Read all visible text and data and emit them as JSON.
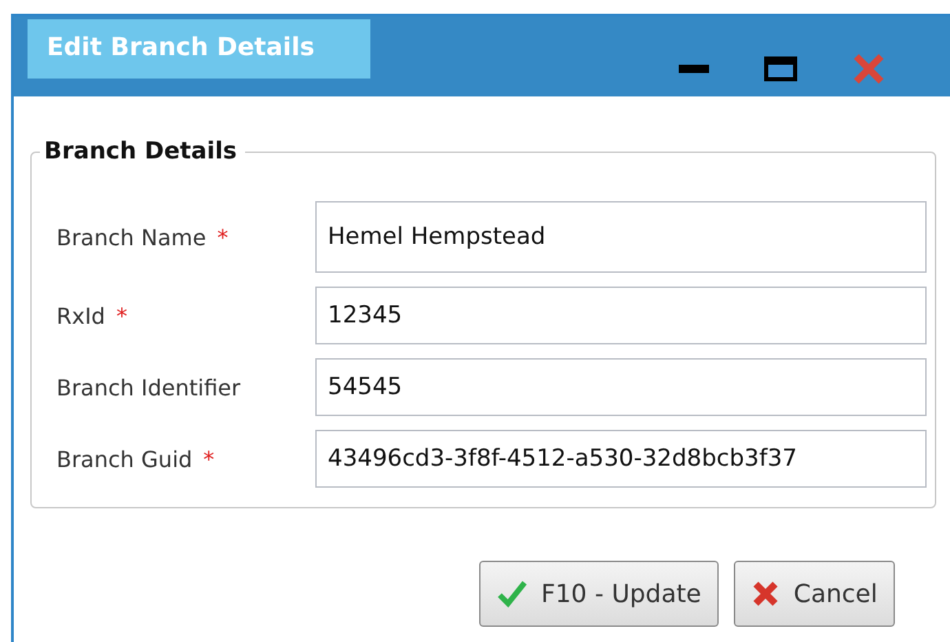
{
  "window": {
    "title": "Edit Branch Details"
  },
  "group": {
    "title": "Branch Details"
  },
  "fields": [
    {
      "label": "Branch Name",
      "required": true,
      "value": "Hemel Hempstead"
    },
    {
      "label": "RxId",
      "required": true,
      "value": "12345"
    },
    {
      "label": "Branch Identifier",
      "required": false,
      "value": "54545"
    },
    {
      "label": "Branch Guid",
      "required": true,
      "value": "43496cd3-3f8f-4512-a530-32d8bcb3f37"
    }
  ],
  "required_mark": "*",
  "buttons": [
    {
      "kind": "confirm",
      "label": "F10 - Update"
    },
    {
      "kind": "cancel",
      "label": "Cancel"
    }
  ]
}
